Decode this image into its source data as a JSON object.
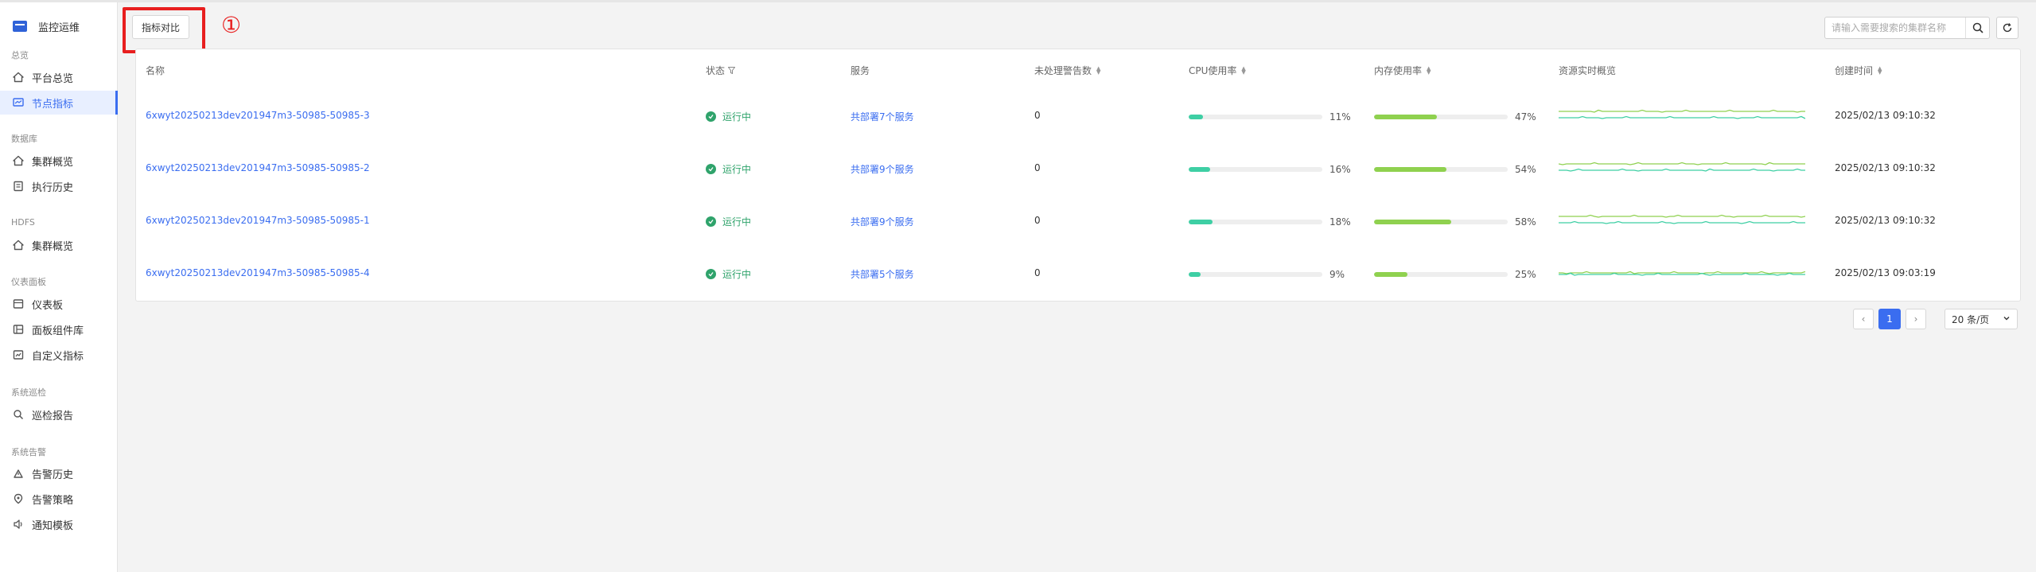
{
  "app": {
    "title": "监控运维"
  },
  "sidebar": {
    "groups": [
      {
        "label": "总览",
        "items": [
          {
            "label": "平台总览",
            "icon": "home-icon"
          },
          {
            "label": "节点指标",
            "icon": "monitor-icon",
            "active": true
          }
        ]
      },
      {
        "label": "数据库",
        "items": [
          {
            "label": "集群概览",
            "icon": "home-icon"
          },
          {
            "label": "执行历史",
            "icon": "history-icon"
          }
        ]
      },
      {
        "label": "HDFS",
        "items": [
          {
            "label": "集群概览",
            "icon": "home-icon"
          }
        ]
      },
      {
        "label": "仪表面板",
        "items": [
          {
            "label": "仪表板",
            "icon": "dashboard-icon"
          },
          {
            "label": "面板组件库",
            "icon": "library-icon"
          },
          {
            "label": "自定义指标",
            "icon": "custom-metric-icon"
          }
        ]
      },
      {
        "label": "系统巡检",
        "items": [
          {
            "label": "巡检报告",
            "icon": "report-search-icon"
          }
        ]
      },
      {
        "label": "系统告警",
        "items": [
          {
            "label": "告警历史",
            "icon": "alert-history-icon"
          },
          {
            "label": "告警策略",
            "icon": "policy-icon"
          },
          {
            "label": "通知模板",
            "icon": "notification-icon"
          }
        ]
      }
    ]
  },
  "toolbar": {
    "compare_label": "指标对比",
    "marker": "①",
    "search_placeholder": "请输入需要搜索的集群名称"
  },
  "table": {
    "columns": [
      "名称",
      "状态",
      "服务",
      "未处理警告数",
      "CPU使用率",
      "内存使用率",
      "资源实时概览",
      "创建时间"
    ],
    "rows": [
      {
        "name": "6xwyt20250213dev201947m3-50985-50985-3",
        "status": "运行中",
        "service": "共部署7个服务",
        "alerts": "0",
        "cpu": "11%",
        "cpu_value": 11,
        "mem": "47%",
        "mem_value": 47,
        "created": "2025/02/13 09:10:32"
      },
      {
        "name": "6xwyt20250213dev201947m3-50985-50985-2",
        "status": "运行中",
        "service": "共部署9个服务",
        "alerts": "0",
        "cpu": "16%",
        "cpu_value": 16,
        "mem": "54%",
        "mem_value": 54,
        "created": "2025/02/13 09:10:32"
      },
      {
        "name": "6xwyt20250213dev201947m3-50985-50985-1",
        "status": "运行中",
        "service": "共部署9个服务",
        "alerts": "0",
        "cpu": "18%",
        "cpu_value": 18,
        "mem": "58%",
        "mem_value": 58,
        "created": "2025/02/13 09:10:32"
      },
      {
        "name": "6xwyt20250213dev201947m3-50985-50985-4",
        "status": "运行中",
        "service": "共部署5个服务",
        "alerts": "0",
        "cpu": "9%",
        "cpu_value": 9,
        "mem": "25%",
        "mem_value": 25,
        "created": "2025/02/13 09:03:19"
      }
    ]
  },
  "pagination": {
    "current": "1",
    "page_size": "20 条/页"
  },
  "colors": {
    "accent": "#3a6df0",
    "cpu": "#3ecfa4",
    "mem": "#8fd14f",
    "status": "#2fa36b",
    "highlight": "#e81e1e"
  }
}
